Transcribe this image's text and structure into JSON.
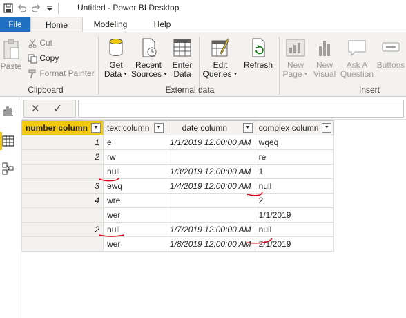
{
  "window": {
    "title": "Untitled - Power BI Desktop"
  },
  "tabs": {
    "file": "File",
    "home": "Home",
    "modeling": "Modeling",
    "help": "Help"
  },
  "ribbon": {
    "clipboard": {
      "paste": "Paste",
      "cut": "Cut",
      "copy": "Copy",
      "format_painter": "Format Painter",
      "group_label": "Clipboard"
    },
    "external_data": {
      "get_data_1": "Get",
      "get_data_2": "Data",
      "recent_sources_1": "Recent",
      "recent_sources_2": "Sources",
      "enter_data_1": "Enter",
      "enter_data_2": "Data",
      "edit_queries_1": "Edit",
      "edit_queries_2": "Queries",
      "refresh": "Refresh",
      "group_label": "External data"
    },
    "insert": {
      "new_page_1": "New",
      "new_page_2": "Page",
      "new_visual_1": "New",
      "new_visual_2": "Visual",
      "ask_question_1": "Ask A",
      "ask_question_2": "Question",
      "buttons": "Buttons",
      "group_label": "Insert"
    }
  },
  "formula_bar": {
    "cancel_glyph": "✕",
    "commit_glyph": "✓"
  },
  "table": {
    "headers": [
      "number column",
      "text column",
      "date column",
      "complex column"
    ],
    "rows": [
      [
        "1",
        "e",
        "1/1/2019 12:00:00 AM",
        "wqeq"
      ],
      [
        "2",
        "rw",
        "",
        "re"
      ],
      [
        "",
        "null",
        "1/3/2019 12:00:00 AM",
        "1"
      ],
      [
        "3",
        "ewq",
        "1/4/2019 12:00:00 AM",
        "null"
      ],
      [
        "4",
        "wre",
        "",
        "2"
      ],
      [
        "",
        "wer",
        "",
        "1/1/2019"
      ],
      [
        "2",
        "null",
        "1/7/2019 12:00:00 AM",
        "null"
      ],
      [
        "",
        "wer",
        "1/8/2019 12:00:00 AM",
        "2/1/2019"
      ]
    ]
  },
  "colors": {
    "file_tab": "#1f6fc2",
    "selected_header": "#f2c811",
    "annotation": "#e0001a",
    "ribbon_bg": "#f3f2f1"
  }
}
